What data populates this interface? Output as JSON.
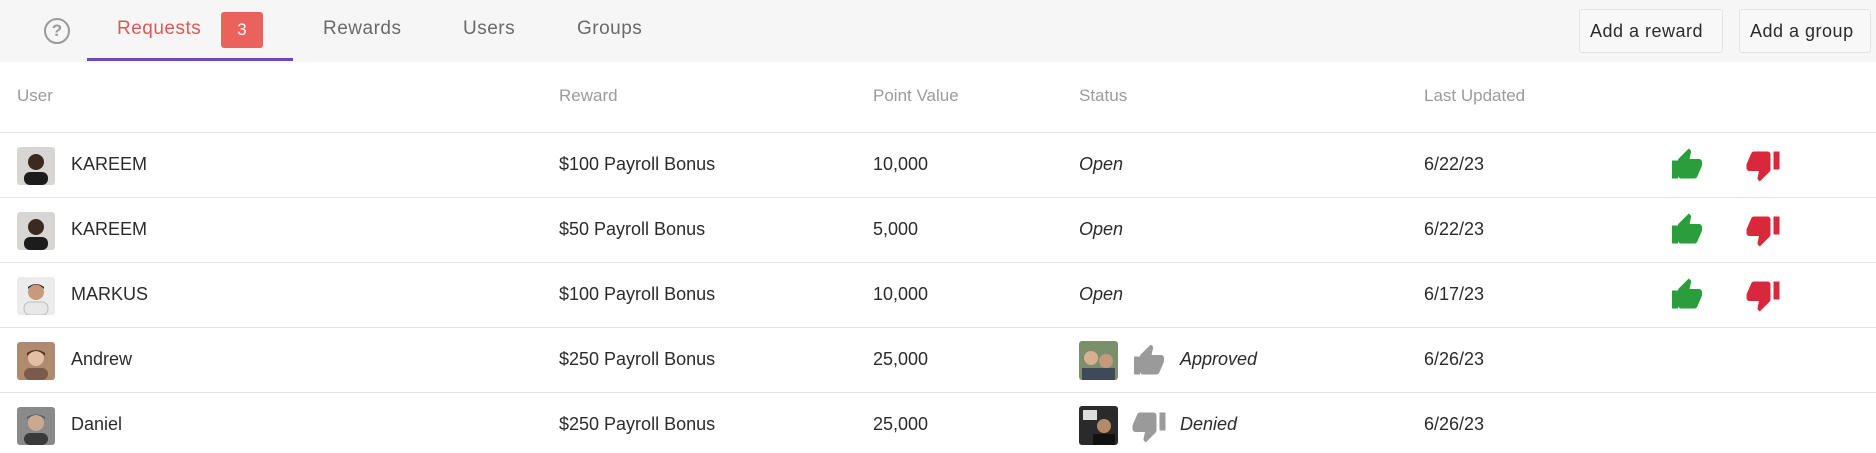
{
  "tabs": [
    {
      "label": "Requests",
      "badge": "3",
      "active": true
    },
    {
      "label": "Rewards"
    },
    {
      "label": "Users"
    },
    {
      "label": "Groups"
    }
  ],
  "actions": {
    "add_reward": "Add a reward",
    "add_group": "Add a group"
  },
  "columns": [
    "User",
    "Reward",
    "Point Value",
    "Status",
    "Last Updated"
  ],
  "rows": [
    {
      "user": "KAREEM",
      "reward": "$100 Payroll Bonus",
      "points": "10,000",
      "status": "Open",
      "updated": "6/22/23"
    },
    {
      "user": "KAREEM",
      "reward": "$50 Payroll Bonus",
      "points": "5,000",
      "status": "Open",
      "updated": "6/22/23"
    },
    {
      "user": "MARKUS",
      "reward": "$100 Payroll Bonus",
      "points": "10,000",
      "status": "Open",
      "updated": "6/17/23"
    },
    {
      "user": "Andrew",
      "reward": "$250 Payroll Bonus",
      "points": "25,000",
      "status": "Approved",
      "updated": "6/26/23"
    },
    {
      "user": "Daniel",
      "reward": "$250 Payroll Bonus",
      "points": "25,000",
      "status": "Denied",
      "updated": "6/26/23"
    }
  ],
  "icons": {
    "help": "question-circle-icon",
    "approve": "thumbs-up-icon",
    "deny": "thumbs-down-icon"
  },
  "colors": {
    "accent": "#6b46c1",
    "active_tab": "#e05757",
    "badge": "#eb625c",
    "approve": "#2a9d3c",
    "deny": "#d9283b",
    "muted": "#9a9a9a"
  }
}
